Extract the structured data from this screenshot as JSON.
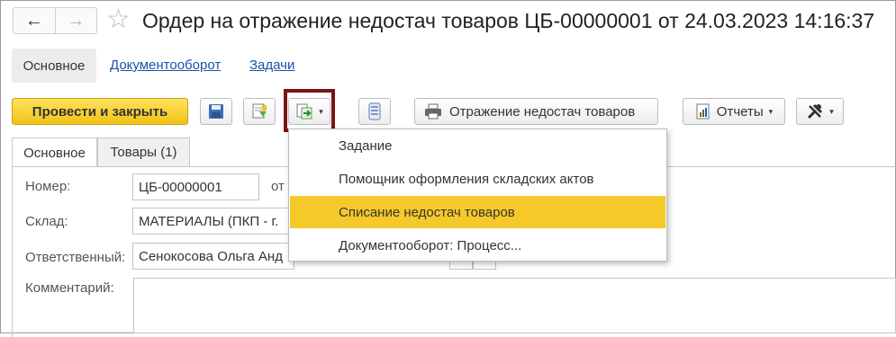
{
  "window": {
    "title": "Ордер на отражение недостач товаров ЦБ-00000001 от 24.03.2023 14:16:37",
    "back_icon": "←",
    "forward_icon": "→",
    "star_icon": "☆"
  },
  "sections": {
    "main": "Основное",
    "docflow": "Документооборот",
    "tasks": "Задачи"
  },
  "toolbar": {
    "post_and_close": "Провести и закрыть",
    "shortage_reflection": "Отражение недостач товаров",
    "reports": "Отчеты",
    "caret": "▾"
  },
  "menu": {
    "items": [
      "Задание",
      "Помощник оформления складских актов",
      "Списание недостач товаров",
      "Документооборот: Процесс..."
    ],
    "active_index": 2,
    "active_color": "#f6c92a"
  },
  "form_tabs": {
    "main": "Основное",
    "goods": "Товары (1)"
  },
  "form": {
    "number_label": "Номер:",
    "number_value": "ЦБ-00000001",
    "number_suffix": "от",
    "warehouse_label": "Склад:",
    "warehouse_value": "МАТЕРИАЛЫ (ПКП - г.",
    "responsible_label": "Ответственный:",
    "responsible_value": "Сенокосова Ольга Анд",
    "comment_label": "Комментарий:"
  },
  "colors": {
    "primary_button": "#f2c217",
    "highlight_frame": "#7a1416",
    "link": "#1a53a8"
  }
}
